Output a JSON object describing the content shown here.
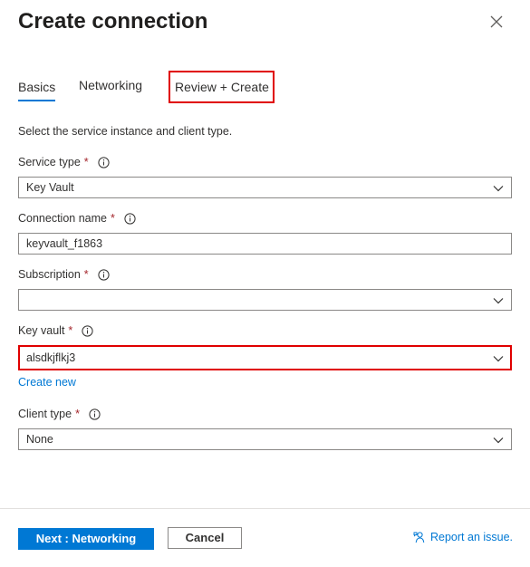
{
  "dialog": {
    "title": "Create connection"
  },
  "tabs": [
    {
      "label": "Basics",
      "selected": true
    },
    {
      "label": "Networking",
      "selected": false
    },
    {
      "label": "Review + Create",
      "selected": false
    }
  ],
  "intro_text": "Select the service instance and client type.",
  "fields": {
    "service_type": {
      "label": "Service type",
      "required_mark": "*",
      "value": ""
    },
    "connection_name": {
      "label": "Connection name",
      "required_mark": "*",
      "value": ""
    },
    "subscription": {
      "label": "Subscription",
      "required_mark": "*",
      "value": ""
    },
    "key_vault": {
      "label": "Key vault",
      "required_mark": "*",
      "value": ""
    },
    "client_type": {
      "label": "Client type",
      "required_mark": "*",
      "value": ""
    }
  },
  "values": {
    "service_type": "Key Vault",
    "connection_name": "keyvault_f1863",
    "subscription": "",
    "key_vault": "alsdkjflkj3",
    "client_type": "None"
  },
  "create_new_link": "Create new",
  "footer": {
    "next_label": "Next : Networking",
    "cancel_label": "Cancel",
    "report_label": "Report an issue."
  },
  "colors": {
    "accent": "#0078d4",
    "required": "#a4262c",
    "highlight_outline": "#e00000"
  },
  "icons": {
    "close": "close-icon",
    "info": "info-icon",
    "chevron": "chevron-down-icon",
    "feedback": "feedback-icon"
  }
}
